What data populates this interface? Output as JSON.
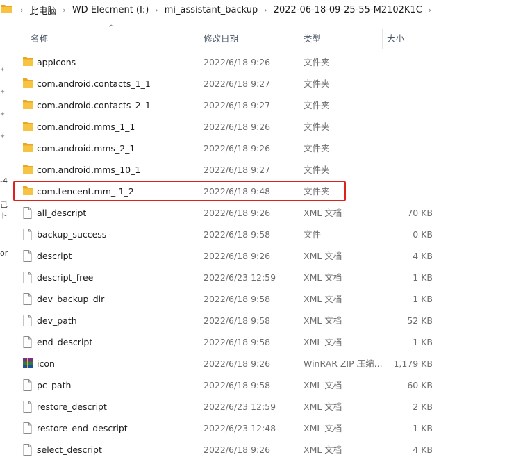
{
  "breadcrumb": [
    "此电脑",
    "WD Elecment (I:)",
    "mi_assistant_backup",
    "2022-06-18-09-25-55-M2102K1C"
  ],
  "columns": {
    "name": "名称",
    "modified": "修改日期",
    "type": "类型",
    "size": "大小"
  },
  "left_strip": [
    "-4",
    "己ト",
    "or"
  ],
  "files": [
    {
      "name": "appIcons",
      "date": "2022/6/18 9:26",
      "type": "文件夹",
      "size": "",
      "icon": "folder-icon"
    },
    {
      "name": "com.android.contacts_1_1",
      "date": "2022/6/18 9:27",
      "type": "文件夹",
      "size": "",
      "icon": "folder-icon"
    },
    {
      "name": "com.android.contacts_2_1",
      "date": "2022/6/18 9:27",
      "type": "文件夹",
      "size": "",
      "icon": "folder-icon"
    },
    {
      "name": "com.android.mms_1_1",
      "date": "2022/6/18 9:26",
      "type": "文件夹",
      "size": "",
      "icon": "folder-icon"
    },
    {
      "name": "com.android.mms_2_1",
      "date": "2022/6/18 9:26",
      "type": "文件夹",
      "size": "",
      "icon": "folder-icon"
    },
    {
      "name": "com.android.mms_10_1",
      "date": "2022/6/18 9:27",
      "type": "文件夹",
      "size": "",
      "icon": "folder-icon"
    },
    {
      "name": "com.tencent.mm_-1_2",
      "date": "2022/6/18 9:48",
      "type": "文件夹",
      "size": "",
      "icon": "folder-icon"
    },
    {
      "name": "all_descript",
      "date": "2022/6/18 9:26",
      "type": "XML 文档",
      "size": "70 KB",
      "icon": "file-icon"
    },
    {
      "name": "backup_success",
      "date": "2022/6/18 9:58",
      "type": "文件",
      "size": "0 KB",
      "icon": "file-icon"
    },
    {
      "name": "descript",
      "date": "2022/6/18 9:26",
      "type": "XML 文档",
      "size": "4 KB",
      "icon": "file-icon"
    },
    {
      "name": "descript_free",
      "date": "2022/6/23 12:59",
      "type": "XML 文档",
      "size": "1 KB",
      "icon": "file-icon"
    },
    {
      "name": "dev_backup_dir",
      "date": "2022/6/18 9:58",
      "type": "XML 文档",
      "size": "1 KB",
      "icon": "file-icon"
    },
    {
      "name": "dev_path",
      "date": "2022/6/18 9:58",
      "type": "XML 文档",
      "size": "52 KB",
      "icon": "file-icon"
    },
    {
      "name": "end_descript",
      "date": "2022/6/18 9:58",
      "type": "XML 文档",
      "size": "1 KB",
      "icon": "file-icon"
    },
    {
      "name": "icon",
      "date": "2022/6/18 9:26",
      "type": "WinRAR ZIP 压缩...",
      "size": "1,179 KB",
      "icon": "winrar-icon"
    },
    {
      "name": "pc_path",
      "date": "2022/6/18 9:58",
      "type": "XML 文档",
      "size": "60 KB",
      "icon": "file-icon"
    },
    {
      "name": "restore_descript",
      "date": "2022/6/23 12:59",
      "type": "XML 文档",
      "size": "2 KB",
      "icon": "file-icon"
    },
    {
      "name": "restore_end_descript",
      "date": "2022/6/23 12:48",
      "type": "XML 文档",
      "size": "1 KB",
      "icon": "file-icon"
    },
    {
      "name": "select_descript",
      "date": "2022/6/18 9:26",
      "type": "XML 文档",
      "size": "4 KB",
      "icon": "file-icon"
    }
  ],
  "highlighted_row": "com.tencent.mm_-1_2",
  "colors": {
    "highlight_border": "#e0201b",
    "folder": "#f6c343",
    "folder_dark": "#e9a824"
  }
}
